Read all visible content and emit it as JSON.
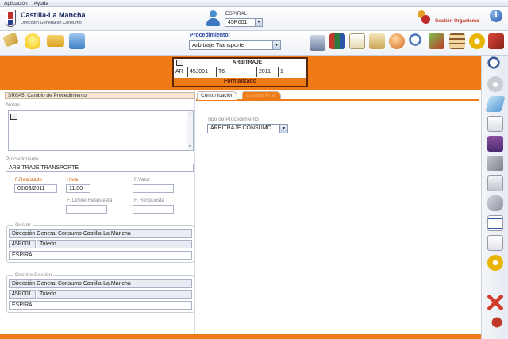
{
  "menu": {
    "items": [
      "Aplicación",
      "Ayuda"
    ]
  },
  "header": {
    "org_title": "Castilla-La Mancha",
    "org_subtitle": "Dirección General de Consumo",
    "espiral_label": "ESPIRAL",
    "espiral_value": "45R001",
    "gestion_label": "Gestión Organismo"
  },
  "procedimiento": {
    "label": "Procedimiento:",
    "value": "Arbitraje Transporte"
  },
  "expediente": {
    "title": "ARBITRAJE",
    "cells": [
      "AR",
      "45J001",
      "T6",
      "2011",
      "1"
    ],
    "status": "Formalizado"
  },
  "left": {
    "section_title": "SR6A5. Cambio de Procedimiento",
    "notas_label": "Notas",
    "procedimiento_label": "Procedimiento",
    "procedimiento_value": "ARBITRAJE TRANSPORTE",
    "f_realizado_label": "F.Realizado",
    "f_realizado_value": "02/03/2011",
    "hora_label": "Hora",
    "hora_value": "11:00",
    "f_valor_label": "F.Valor",
    "f_limite_label": "F. Límite Respuesta",
    "f_respuesta_label": "F. Respuesta",
    "gestor": {
      "legend": "Gestor",
      "nombre": "Dirección General Consumo Castilla-La Mancha",
      "codigo": "45R001",
      "ciudad": "Toledo",
      "espiral": "ESPIRAL . ."
    },
    "destino": {
      "legend": "Destino Gestión",
      "nombre": "Dirección General Consumo Castilla-La Mancha",
      "codigo": "45R001",
      "ciudad": "Toledo",
      "espiral": "ESPIRAL . ."
    }
  },
  "right": {
    "tabs": [
      "Comunicación",
      "Cambio Proc."
    ],
    "tipo_label": "Tipo de Procedimiento",
    "tipo_value": "ARBITRAJE CONSUMO"
  },
  "colors": {
    "accent_orange": "#f07b16",
    "brand_blue": "#1a2860"
  },
  "toolbar_icons": [
    "tag-icon",
    "lightbulb-icon",
    "folder-icon",
    "network-icon",
    "computer-icon",
    "books-icon",
    "document-icon",
    "clipboard-icon",
    "globe-icon",
    "magnifier-icon",
    "tools-icon",
    "abacus-icon",
    "gears-icon",
    "book-icon"
  ],
  "side_icons": [
    "search-icon",
    "disc-icon",
    "eraser-icon",
    "page-icon",
    "save-icon",
    "tools-icon",
    "copy-icon",
    "attach-icon",
    "list-icon",
    "font-icon",
    "settings-icon",
    "cancel-icon",
    "exit-icon"
  ]
}
